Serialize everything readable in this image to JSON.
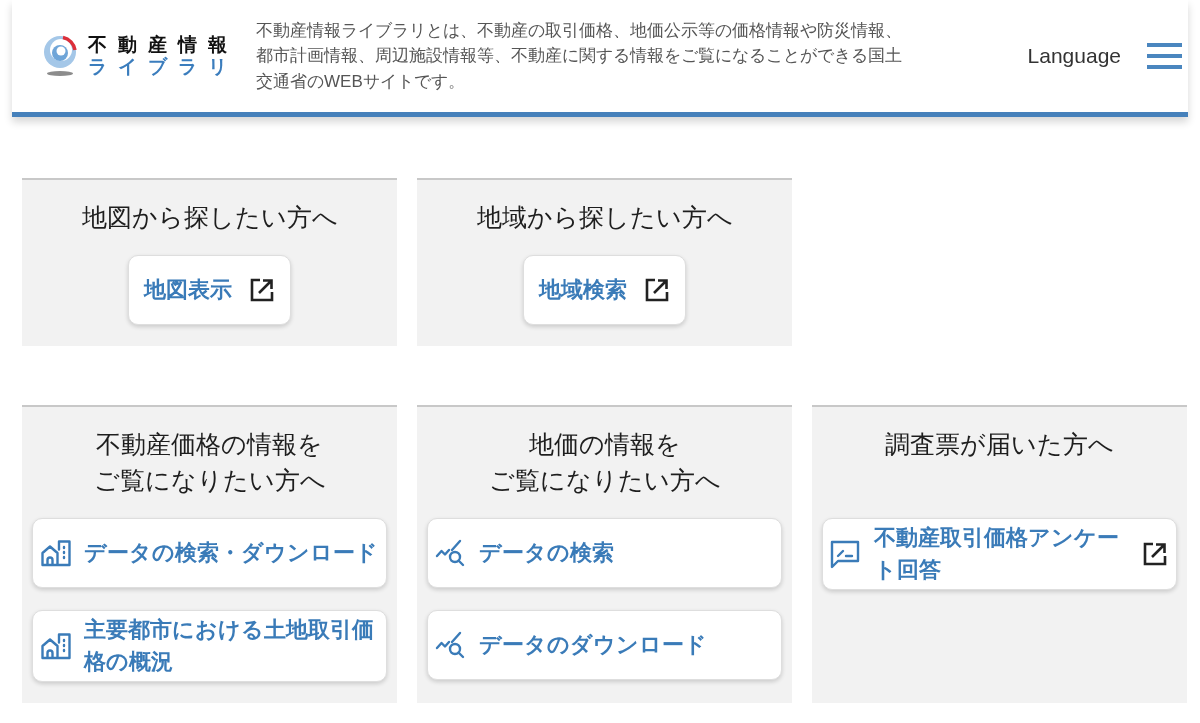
{
  "header": {
    "logo": {
      "title": "不動産情報",
      "subtitle": "ライブラリ"
    },
    "description": "不動産情報ライブラリとは、不動産の取引価格、地価公示等の価格情報や防災情報、都市計画情報、周辺施設情報等、不動産に関する情報をご覧になることができる国土交通省のWEBサイトです。",
    "language": "Language"
  },
  "section_rows": [
    [
      {
        "title_lines": [
          "地図から探したい方へ"
        ],
        "links": [
          {
            "kind": "plain",
            "label": "地図表示",
            "external": true
          }
        ]
      },
      {
        "title_lines": [
          "地域から探したい方へ"
        ],
        "links": [
          {
            "kind": "plain",
            "label": "地域検索",
            "external": true
          }
        ]
      }
    ],
    [
      {
        "title_lines": [
          "不動産価格の情報を",
          "ご覧になりたい方へ"
        ],
        "links": [
          {
            "kind": "building",
            "label": "データの検索・ダウンロード",
            "external": false
          },
          {
            "kind": "building",
            "label": "主要都市における土地取引価格の概況",
            "external": false
          }
        ]
      },
      {
        "title_lines": [
          "地価の情報を",
          "ご覧になりたい方へ"
        ],
        "links": [
          {
            "kind": "chart",
            "label": "データの検索",
            "external": false
          },
          {
            "kind": "chart",
            "label": "データのダウンロード",
            "external": false
          }
        ]
      },
      {
        "title_lines": [
          "調査票が届いた方へ"
        ],
        "links": [
          {
            "kind": "survey",
            "label": "不動産取引価格アンケート回答",
            "external": true
          }
        ]
      }
    ]
  ]
}
